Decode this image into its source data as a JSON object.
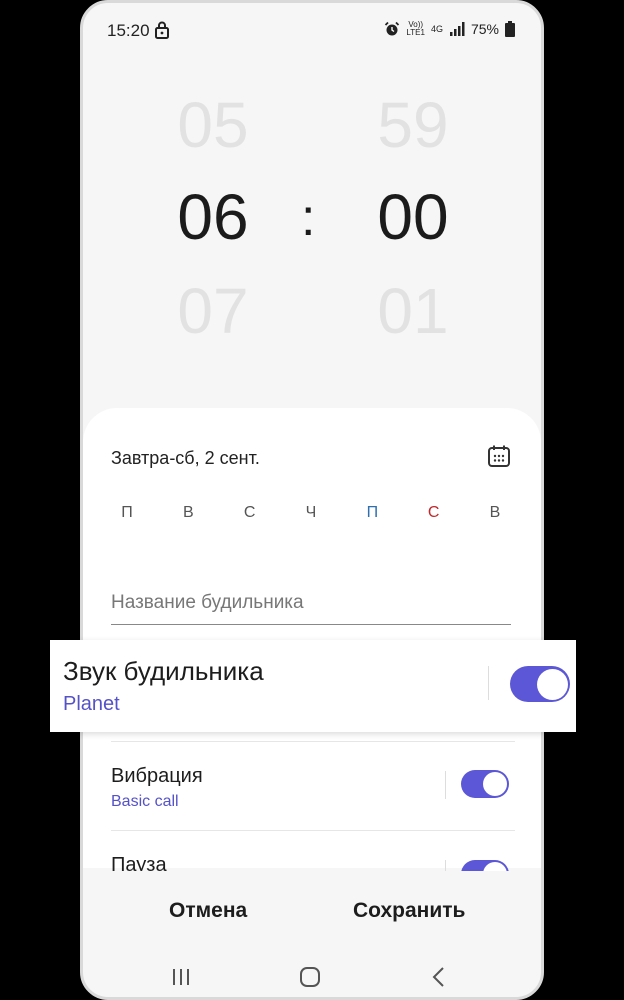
{
  "status_bar": {
    "time": "15:20",
    "volte_top": "Vo))",
    "volte_bottom": "LTE1",
    "network": "4G",
    "battery": "75%"
  },
  "picker": {
    "hours": {
      "prev": "05",
      "current": "06",
      "next": "07"
    },
    "separator": ":",
    "minutes": {
      "prev": "59",
      "current": "00",
      "next": "01"
    }
  },
  "date_label": "Завтра-сб, 2 сент.",
  "weekdays": [
    {
      "label": "П",
      "color": "#555555"
    },
    {
      "label": "В",
      "color": "#555555"
    },
    {
      "label": "С",
      "color": "#555555"
    },
    {
      "label": "Ч",
      "color": "#555555"
    },
    {
      "label": "П",
      "color": "#2d6fb0"
    },
    {
      "label": "С",
      "color": "#c0282b"
    },
    {
      "label": "В",
      "color": "#555555"
    }
  ],
  "alarm_name_placeholder": "Название будильника",
  "settings": {
    "sound": {
      "title": "Звук будильника",
      "value": "Planet",
      "enabled": true
    },
    "vibration": {
      "title": "Вибрация",
      "value": "Basic call",
      "enabled": true
    },
    "pause": {
      "title": "Пауза",
      "enabled": true
    }
  },
  "buttons": {
    "cancel": "Отмена",
    "save": "Сохранить"
  },
  "colors": {
    "accent": "#5b57d6",
    "accent_text": "#5552c8"
  }
}
